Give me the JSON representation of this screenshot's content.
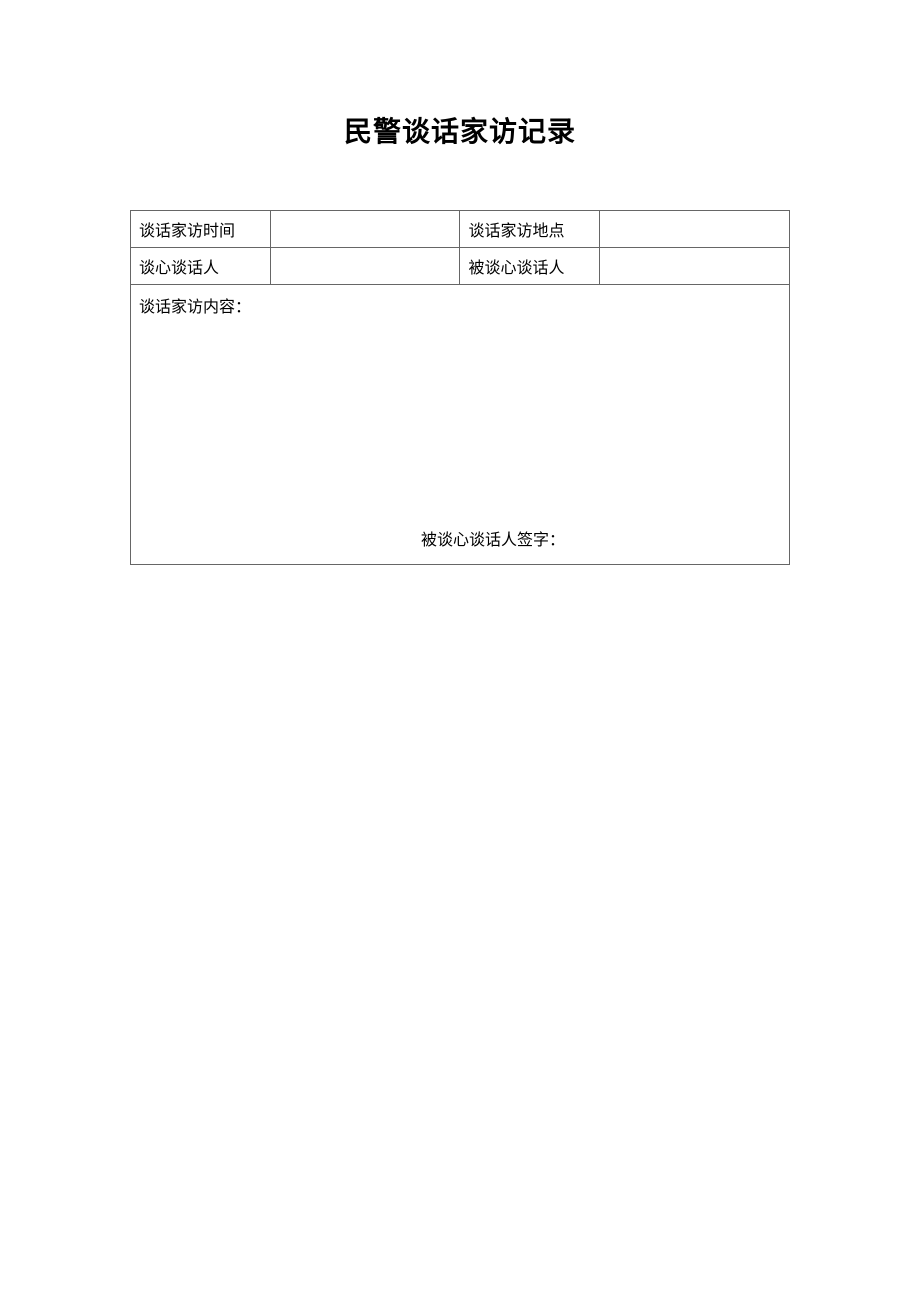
{
  "title": "民警谈话家访记录",
  "form": {
    "row1": {
      "label1": "谈话家访时间",
      "value1": "",
      "label2": "谈话家访地点",
      "value2": ""
    },
    "row2": {
      "label1": "谈心谈话人",
      "value1": "",
      "label2": "被谈心谈话人",
      "value2": ""
    },
    "content": {
      "label": "谈话家访内容：",
      "signature_label": "被谈心谈话人签字："
    }
  }
}
